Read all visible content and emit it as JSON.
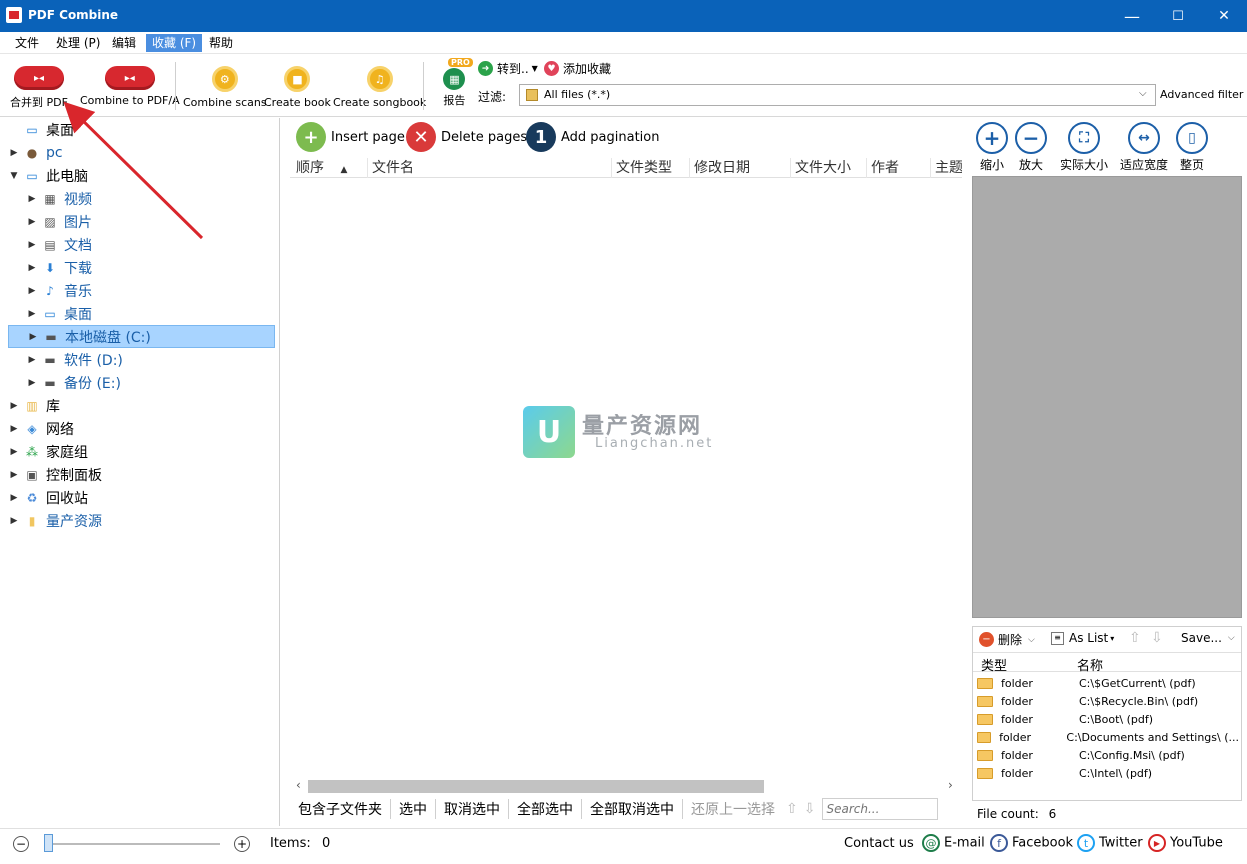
{
  "window": {
    "title": "PDF Combine",
    "minimize": "—",
    "maximize": "☐",
    "close": "✕"
  },
  "menu": [
    "文件",
    "处理 (P)",
    "编辑",
    "收藏 (F)",
    "帮助"
  ],
  "toolbar": {
    "merge_label": "合并到 PDF",
    "combine_pdfa_label": "Combine to PDF/A",
    "combine_scans_label": "Combine scans",
    "create_book_label": "Create book",
    "create_songbook_label": "Create songbook",
    "pro_badge": "PRO",
    "report_label": "报告",
    "goto_label": "转到..",
    "add_fav_label": "添加收藏",
    "filter_label": "过滤:",
    "filter_value": "All files (*.*)",
    "advanced_filter": "Advanced filter"
  },
  "tree": [
    {
      "label": "桌面",
      "level": 0,
      "icon": "desktop-icon",
      "arrow": ""
    },
    {
      "label": "pc",
      "level": 0,
      "icon": "user-icon",
      "arrow": "▶"
    },
    {
      "label": "此电脑",
      "level": 0,
      "icon": "computer-icon",
      "arrow": "▼"
    },
    {
      "label": "视频",
      "level": 1,
      "icon": "video-icon",
      "arrow": "▶"
    },
    {
      "label": "图片",
      "level": 1,
      "icon": "picture-icon",
      "arrow": "▶"
    },
    {
      "label": "文档",
      "level": 1,
      "icon": "document-icon",
      "arrow": "▶"
    },
    {
      "label": "下载",
      "level": 1,
      "icon": "download-icon",
      "arrow": "▶"
    },
    {
      "label": "音乐",
      "level": 1,
      "icon": "music-icon",
      "arrow": "▶"
    },
    {
      "label": "桌面",
      "level": 1,
      "icon": "desktop-icon",
      "arrow": "▶"
    },
    {
      "label": "本地磁盘 (C:)",
      "level": 1,
      "icon": "drive-icon",
      "arrow": "▶",
      "selected": true
    },
    {
      "label": "软件 (D:)",
      "level": 1,
      "icon": "drive-icon",
      "arrow": "▶"
    },
    {
      "label": "备份 (E:)",
      "level": 1,
      "icon": "drive-icon",
      "arrow": "▶"
    },
    {
      "label": "库",
      "level": 0,
      "icon": "library-icon",
      "arrow": "▶"
    },
    {
      "label": "网络",
      "level": 0,
      "icon": "network-icon",
      "arrow": "▶"
    },
    {
      "label": "家庭组",
      "level": 0,
      "icon": "homegroup-icon",
      "arrow": "▶"
    },
    {
      "label": "控制面板",
      "level": 0,
      "icon": "control-panel-icon",
      "arrow": "▶"
    },
    {
      "label": "回收站",
      "level": 0,
      "icon": "recycle-bin-icon",
      "arrow": "▶"
    },
    {
      "label": "量产资源",
      "level": 0,
      "icon": "folder-icon",
      "arrow": "▶"
    }
  ],
  "center": {
    "insert_page": "Insert page",
    "delete_pages": "Delete pages",
    "add_pagination": "Add pagination",
    "columns": [
      "顺序",
      "文件名",
      "文件类型",
      "修改日期",
      "文件大小",
      "作者",
      "主题"
    ],
    "sort_indicator": "▲",
    "watermark_cn": "量产资源网",
    "watermark_en": "Liangchan.net",
    "bottom": {
      "include_sub": "包含子文件夹",
      "select": "选中",
      "unselect": "取消选中",
      "select_all": "全部选中",
      "unselect_all": "全部取消选中",
      "restore": "还原上一选择",
      "search_placeholder": "Search..."
    }
  },
  "right": {
    "zoom_out": "缩小",
    "zoom_in": "放大",
    "actual_size": "实际大小",
    "fit_width": "适应宽度",
    "full_page": "整页",
    "delete_label": "删除",
    "as_list_label": "As List",
    "save_label": "Save...",
    "col_type": "类型",
    "col_name": "名称",
    "favorites": [
      {
        "type": "folder",
        "name": "C:\\$GetCurrent\\ (pdf)"
      },
      {
        "type": "folder",
        "name": "C:\\$Recycle.Bin\\ (pdf)"
      },
      {
        "type": "folder",
        "name": "C:\\Boot\\ (pdf)"
      },
      {
        "type": "folder",
        "name": "C:\\Documents and Settings\\ (..."
      },
      {
        "type": "folder",
        "name": "C:\\Config.Msi\\ (pdf)"
      },
      {
        "type": "folder",
        "name": "C:\\Intel\\ (pdf)"
      }
    ],
    "file_count_label": "File count:",
    "file_count": "6"
  },
  "status": {
    "items_label": "Items:",
    "items_value": "0",
    "contact": "Contact us",
    "email": "E-mail",
    "facebook": "Facebook",
    "twitter": "Twitter",
    "youtube": "YouTube"
  },
  "colors": {
    "titlebar": "#0a62b9",
    "selection": "#a8d4ff",
    "annotation_arrow": "#d9262c"
  }
}
